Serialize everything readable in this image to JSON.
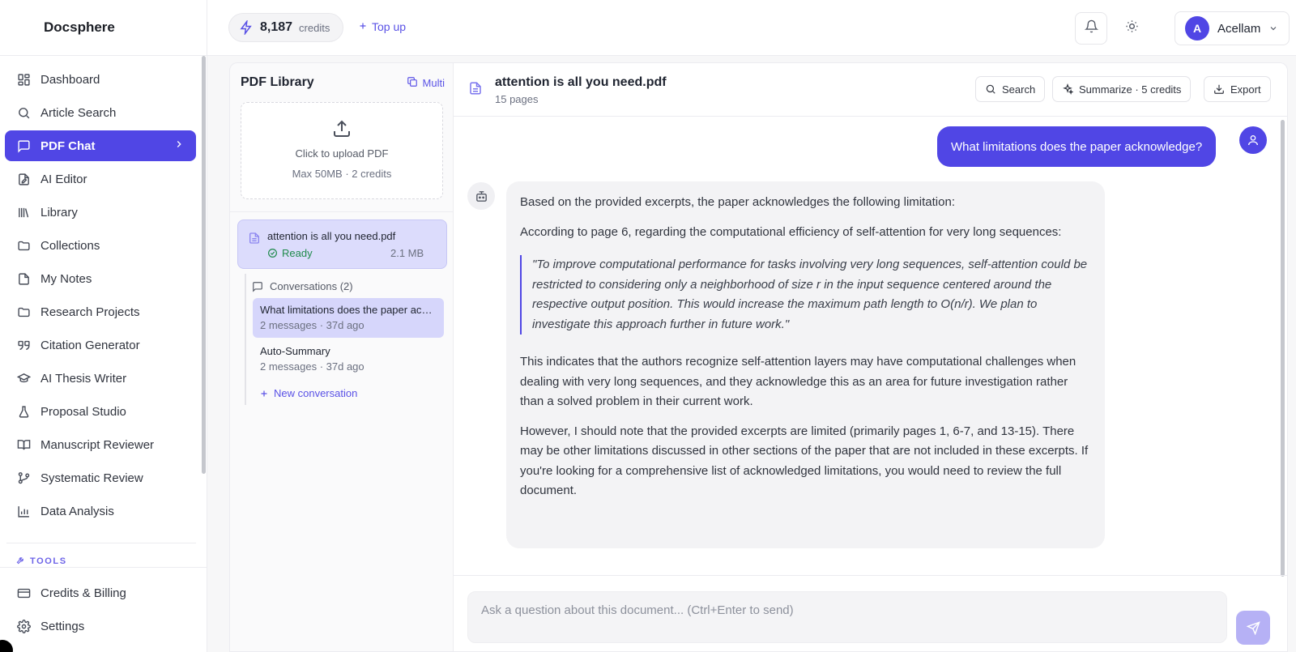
{
  "app": {
    "brand": "Docsphere"
  },
  "sidebar": {
    "items": [
      {
        "label": "Dashboard",
        "icon": "dashboard-icon"
      },
      {
        "label": "Article Search",
        "icon": "search-icon"
      },
      {
        "label": "PDF Chat",
        "icon": "chat-icon",
        "active": true
      },
      {
        "label": "AI Editor",
        "icon": "edit-document-icon"
      },
      {
        "label": "Library",
        "icon": "library-icon"
      },
      {
        "label": "Collections",
        "icon": "folder-icon"
      },
      {
        "label": "My Notes",
        "icon": "notes-icon"
      },
      {
        "label": "Research Projects",
        "icon": "folder-icon"
      },
      {
        "label": "Citation Generator",
        "icon": "quote-icon"
      },
      {
        "label": "AI Thesis Writer",
        "icon": "graduation-cap-icon"
      },
      {
        "label": "Proposal Studio",
        "icon": "flask-icon"
      },
      {
        "label": "Manuscript Reviewer",
        "icon": "book-icon"
      },
      {
        "label": "Systematic Review",
        "icon": "git-branch-icon"
      },
      {
        "label": "Data Analysis",
        "icon": "bar-chart-icon"
      }
    ],
    "tools_label": "TOOLS",
    "bottom_items": [
      {
        "label": "Credits & Billing",
        "icon": "credit-card-icon"
      },
      {
        "label": "Settings",
        "icon": "gear-icon"
      }
    ]
  },
  "topbar": {
    "credits_value": "8,187",
    "credits_label": "credits",
    "topup_label": "Top up",
    "user": {
      "initial": "A",
      "name": "Acellam"
    }
  },
  "library": {
    "title": "PDF Library",
    "multi_label": "Multi",
    "upload": {
      "title": "Click to upload PDF",
      "subtitle": "Max 50MB · 2 credits"
    },
    "file": {
      "name": "attention is all you need.pdf",
      "status": "Ready",
      "size": "2.1 MB"
    },
    "conversations_header": "Conversations (2)",
    "conversations": [
      {
        "title": "What limitations does the paper acknowledge?",
        "meta": "2 messages · 37d ago",
        "active": true
      },
      {
        "title": "Auto-Summary",
        "meta": "2 messages · 37d ago",
        "active": false
      }
    ],
    "new_conversation_label": "New conversation"
  },
  "chat": {
    "doc_title": "attention is all you need.pdf",
    "doc_pages": "15 pages",
    "buttons": {
      "search": "Search",
      "summarize": "Summarize · 5 credits",
      "export": "Export"
    },
    "user_message": "What limitations does the paper acknowledge?",
    "bot": {
      "p1": "Based on the provided excerpts, the paper acknowledges the following limitation:",
      "p2": "According to page 6, regarding the computational efficiency of self-attention for very long sequences:",
      "quote": "\"To improve computational performance for tasks involving very long sequences, self-attention could be restricted to considering only a neighborhood of size r in the input sequence centered around the respective output position. This would increase the maximum path length to O(n/r). We plan to investigate this approach further in future work.\"",
      "p3": "This indicates that the authors recognize self-attention layers may have computational challenges when dealing with very long sequences, and they acknowledge this as an area for future investigation rather than a solved problem in their current work.",
      "p4": "However, I should note that the provided excerpts are limited (primarily pages 1, 6-7, and 13-15). There may be other limitations discussed in other sections of the paper that are not included in these excerpts. If you're looking for a comprehensive list of acknowledged limitations, you would need to review the full document."
    },
    "input_placeholder": "Ask a question about this document... (Ctrl+Enter to send)"
  },
  "colors": {
    "accent": "#5046e5",
    "accent_light": "#dcdcfc",
    "success": "#1f8a4c"
  }
}
